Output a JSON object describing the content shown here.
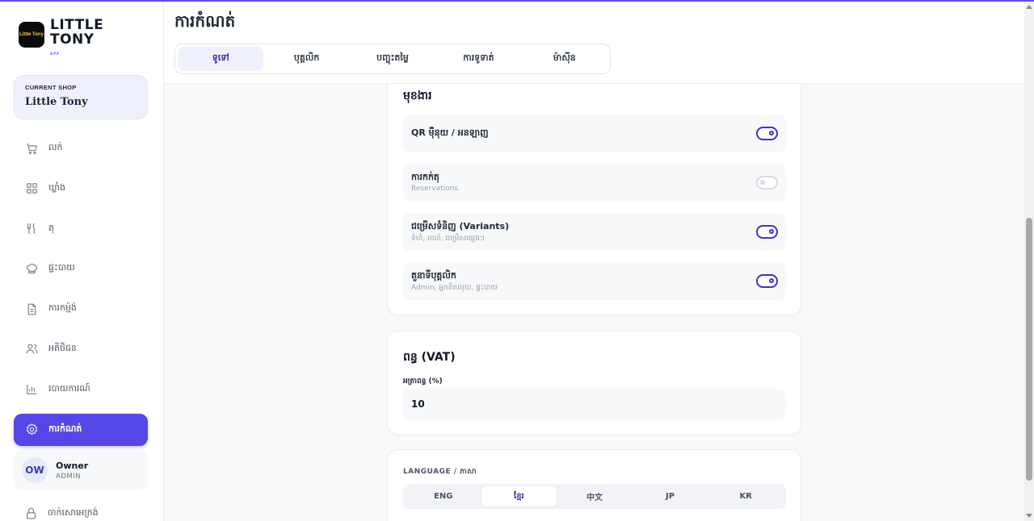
{
  "brand": {
    "name_line1": "LITTLE",
    "name_line2": "TONY",
    "sub": "APP",
    "logo_text": "Little Tony"
  },
  "shop": {
    "label": "CURRENT SHOP",
    "name": "Little Tony"
  },
  "sidebar": {
    "items": [
      {
        "label": "លក់",
        "icon": "cart-icon"
      },
      {
        "label": "ឃ្លាំង",
        "icon": "grid-icon"
      },
      {
        "label": "តុ",
        "icon": "utensils-icon"
      },
      {
        "label": "ផ្ទះបាយ",
        "icon": "chef-hat-icon"
      },
      {
        "label": "ការកម្ម៉ង់",
        "icon": "document-icon"
      },
      {
        "label": "អតិថិជន",
        "icon": "users-icon"
      },
      {
        "label": "របាយការណ៍",
        "icon": "bar-chart-icon"
      },
      {
        "label": "ការកំណត់",
        "icon": "gear-icon",
        "active": true
      }
    ]
  },
  "user": {
    "initials": "OW",
    "name": "Owner",
    "role": "ADMIN"
  },
  "logout": {
    "label": "ចាក់សោអេក្រង់"
  },
  "header": {
    "title": "ការកំណត់",
    "tabs": [
      "ទូទៅ",
      "បុគ្គលិក",
      "បញ្ចុះតម្លៃ",
      "ការទូទាត់",
      "ម៉ាស៊ីន"
    ],
    "active_tab": 0
  },
  "features": {
    "title": "មុខងារ",
    "items": [
      {
        "label": "QR ម៉ឺនុយ / អនឡាញ",
        "sub": "",
        "on": true
      },
      {
        "label": "ការកក់តុ",
        "sub": "Reservations",
        "on": false
      },
      {
        "label": "ជម្រើសទំនិញ (Variants)",
        "sub": "ទំហំ, ពណ៌, ជម្រើសផ្សេងៗ",
        "on": true
      },
      {
        "label": "តួនាទីបុគ្គលិក",
        "sub": "Admin, អ្នកគិតលុយ, ផ្ទះបាយ",
        "on": true
      }
    ]
  },
  "vat": {
    "title": "ពន្ធ (VAT)",
    "field_label": "អត្រាពន្ធ (%)",
    "value": "10"
  },
  "language": {
    "label": "LANGUAGE / ភាសា",
    "options": [
      "ENG",
      "ខ្មែរ",
      "中文",
      "JP",
      "KR"
    ],
    "active": 1
  },
  "colors": {
    "accent": "#5546e8",
    "switch_on": "#3b34c9"
  }
}
